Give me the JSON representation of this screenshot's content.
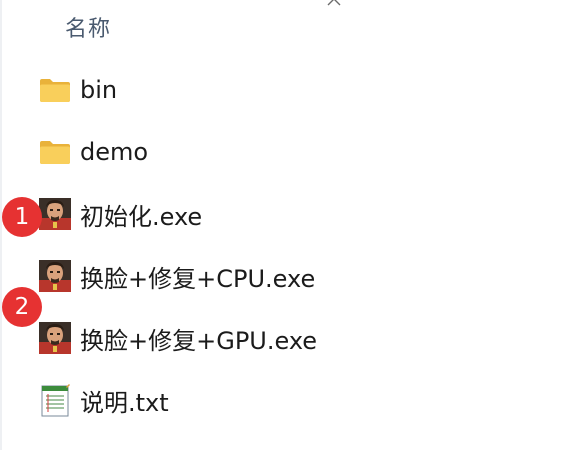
{
  "header": {
    "name_column": "名称"
  },
  "files": [
    {
      "name": "bin",
      "icon": "folder-icon"
    },
    {
      "name": "demo",
      "icon": "folder-icon"
    },
    {
      "name": "初始化.exe",
      "icon": "app-icon"
    },
    {
      "name": "换脸+修复+CPU.exe",
      "icon": "app-icon"
    },
    {
      "name": "换脸+修复+GPU.exe",
      "icon": "app-icon"
    },
    {
      "name": "说明.txt",
      "icon": "notepad-icon"
    }
  ],
  "annotations": [
    {
      "label": "1"
    },
    {
      "label": "2"
    }
  ],
  "colors": {
    "badge": "#e63232",
    "folder": "#f5c543",
    "header_text": "#4a5a6f"
  }
}
